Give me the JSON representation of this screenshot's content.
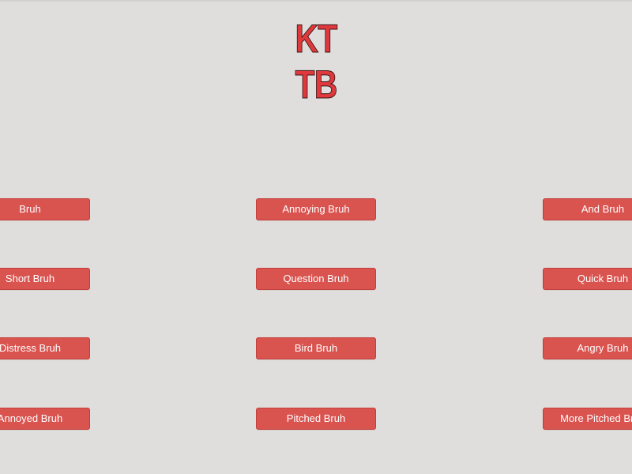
{
  "logo": {
    "line1": "KT",
    "line2": "TB"
  },
  "buttons": {
    "left": [
      "Bruh",
      "Short Bruh",
      "Distress Bruh",
      "Annoyed Bruh"
    ],
    "middle": [
      "Annoying Bruh",
      "Question Bruh",
      "Bird Bruh",
      "Pitched Bruh"
    ],
    "right": [
      "And Bruh",
      "Quick Bruh",
      "Angry Bruh",
      "More Pitched Bruh"
    ]
  },
  "colors": {
    "background": "#dfdedc",
    "button": "#d9534f",
    "button_text": "#ffffff",
    "logo": "#e0393d"
  }
}
